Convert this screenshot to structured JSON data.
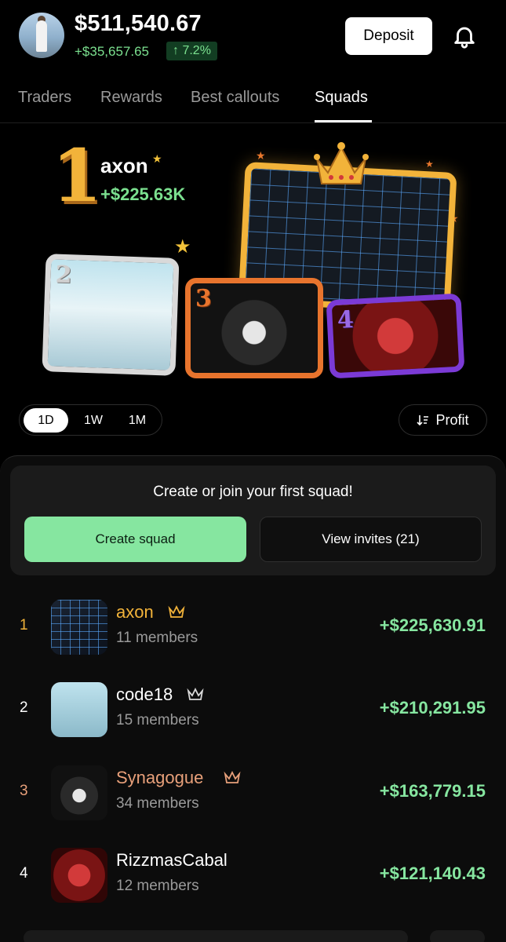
{
  "header": {
    "balance": "$511,540.67",
    "delta": "+$35,657.65",
    "pct": "↑ 7.2%",
    "deposit_label": "Deposit",
    "icons": [
      "avatar",
      "bell-icon"
    ]
  },
  "tabs": [
    {
      "label": "Traders"
    },
    {
      "label": "Rewards"
    },
    {
      "label": "Best callouts"
    },
    {
      "label": "Squads"
    }
  ],
  "podium": {
    "first_rank": "1",
    "first_name": "axon",
    "first_profit": "+$225.63K",
    "cards": [
      {
        "rank": "2"
      },
      {
        "rank": "3"
      },
      {
        "rank": "4"
      }
    ]
  },
  "filters": {
    "periods": [
      {
        "label": "1D"
      },
      {
        "label": "1W"
      },
      {
        "label": "1M"
      }
    ],
    "selected_period": "1D",
    "sort_label": "Profit"
  },
  "invite": {
    "title": "Create or join your first squad!",
    "create_label": "Create squad",
    "invites_label": "View invites (21)"
  },
  "squads": [
    {
      "rank": "1",
      "name": "axon",
      "members": "11 members",
      "profit": "+$225,630.91"
    },
    {
      "rank": "2",
      "name": "code18",
      "members": "15 members",
      "profit": "+$210,291.95"
    },
    {
      "rank": "3",
      "name": "Synagogue",
      "members": "34 members",
      "profit": "+$163,779.15"
    },
    {
      "rank": "4",
      "name": "RizzmasCabal",
      "members": "12 members",
      "profit": "+$121,140.43"
    }
  ],
  "colors": {
    "accent_green": "#86e6a0",
    "gold": "#f2b33a",
    "bronze": "#e8742d",
    "purple": "#7b3ad6"
  }
}
